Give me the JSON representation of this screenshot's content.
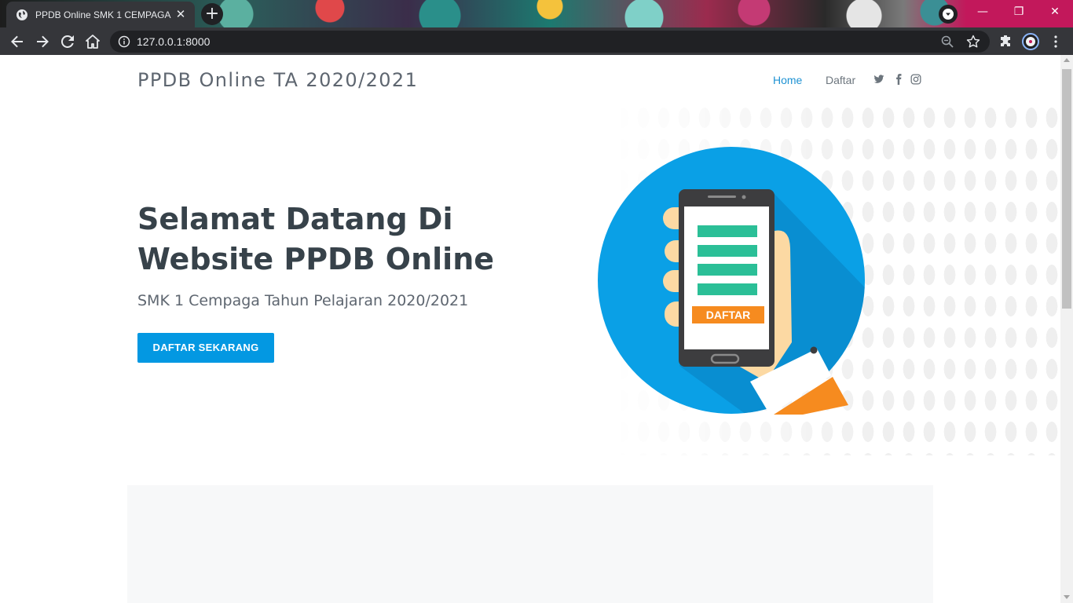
{
  "browser": {
    "tab_title": "PPDB Online SMK 1 CEMPAGA",
    "tab_close": "✕",
    "new_tab": "+",
    "url": "127.0.0.1:8000",
    "window_controls": {
      "minimize": "—",
      "maximize": "❐",
      "close": "✕"
    }
  },
  "site": {
    "brand": "PPDB Online TA 2020/2021",
    "nav": {
      "home": "Home",
      "daftar": "Daftar"
    },
    "social": [
      "twitter-icon",
      "facebook-icon",
      "instagram-icon"
    ]
  },
  "hero": {
    "title": "Selamat Datang Di Website PPDB Online",
    "subtitle": "SMK 1 Cempaga Tahun Pelajaran 2020/2021",
    "cta": "DAFTAR SEKARANG",
    "illustration_label": "DAFTAR"
  },
  "colors": {
    "accent": "#0398e2",
    "nav_active": "#1e92d3",
    "heading": "#37424a",
    "text_muted": "#5e6670",
    "illustration_circle": "#0aa0e6",
    "form_lines": "#2bbf97",
    "daftar_badge": "#f68b1f"
  }
}
